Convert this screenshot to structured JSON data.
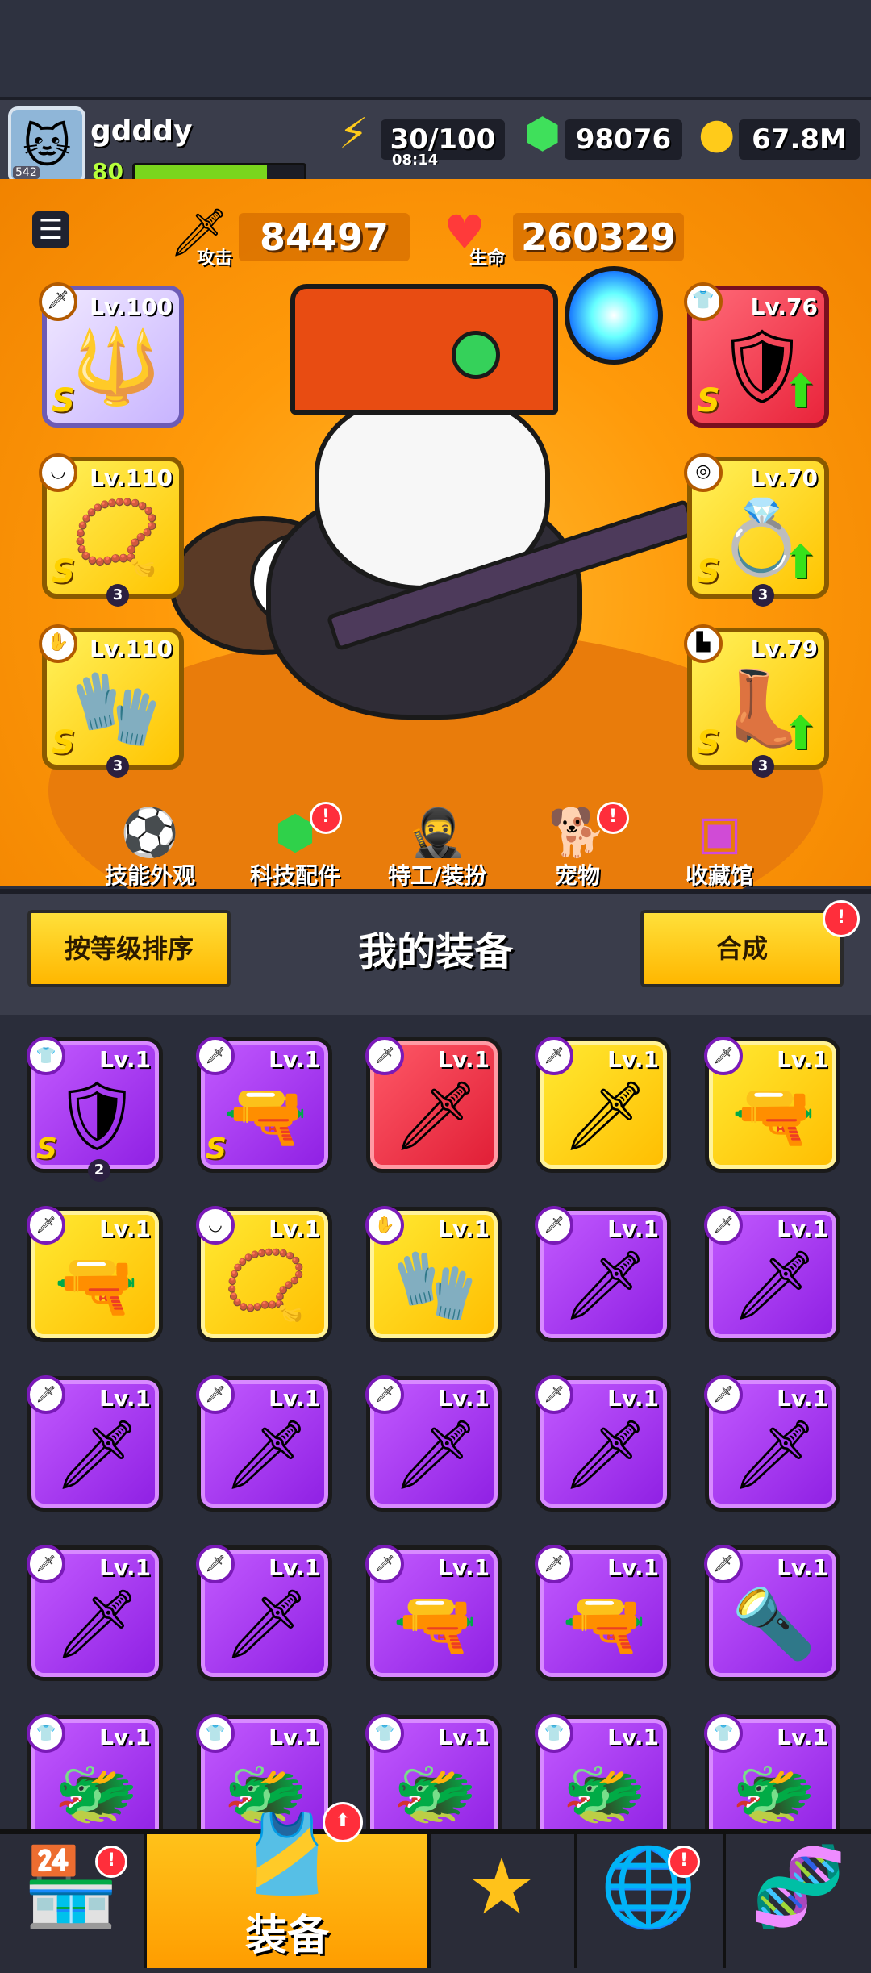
{
  "player": {
    "name": "gdddy",
    "level": "80",
    "xp_fraction": 0.78,
    "avatar_tag": "542"
  },
  "resources": {
    "energy": "30/100",
    "energy_timer": "08:14",
    "gems": "98076",
    "gold": "67.8M"
  },
  "stats": {
    "attack_value": "84497",
    "attack_label": "攻击",
    "hp_value": "260329",
    "hp_label": "生命"
  },
  "equipped": {
    "weapon": {
      "level": "Lv.100",
      "grade": "S",
      "icon": "staff-icon",
      "color": "purple"
    },
    "necklace": {
      "level": "Lv.110",
      "grade": "S",
      "stars": "3",
      "icon": "necklace-icon"
    },
    "gloves": {
      "level": "Lv.110",
      "grade": "S",
      "stars": "3",
      "icon": "gloves-icon"
    },
    "armor": {
      "level": "Lv.76",
      "grade": "S",
      "icon": "armor-icon",
      "color": "red"
    },
    "belt": {
      "level": "Lv.70",
      "grade": "S",
      "stars": "3",
      "icon": "belt-icon"
    },
    "boots": {
      "level": "Lv.79",
      "grade": "S",
      "stars": "3",
      "icon": "boots-icon"
    }
  },
  "hero_nav": [
    {
      "label": "技能外观",
      "icon": "soccer-icon",
      "badge": false
    },
    {
      "label": "科技配件",
      "icon": "tech-icon",
      "badge": true
    },
    {
      "label": "特工/装扮",
      "icon": "agent-icon",
      "badge": false
    },
    {
      "label": "宠物",
      "icon": "dog-icon",
      "badge": true
    },
    {
      "label": "收藏馆",
      "icon": "collection-icon",
      "badge": false
    }
  ],
  "equipment_panel": {
    "sort_button": "按等级排序",
    "title": "我的装备",
    "merge_button": "合成",
    "badge": "!"
  },
  "inventory": [
    {
      "level": "Lv.1",
      "color": "purple",
      "icon": "armor-icon",
      "glyph": "🛡",
      "grade": "S",
      "stars": "2",
      "slot": "armor"
    },
    {
      "level": "Lv.1",
      "color": "purple",
      "icon": "blaster-icon",
      "glyph": "🔫",
      "grade": "S",
      "slot": "weapon"
    },
    {
      "level": "Lv.1",
      "color": "red",
      "icon": "kunai-icon",
      "glyph": "🗡",
      "slot": "weapon"
    },
    {
      "level": "Lv.1",
      "color": "yellow",
      "icon": "kunai-icon",
      "glyph": "🗡",
      "slot": "weapon"
    },
    {
      "level": "Lv.1",
      "color": "yellow",
      "icon": "revolver-icon",
      "glyph": "🔫",
      "slot": "weapon"
    },
    {
      "level": "Lv.1",
      "color": "yellow",
      "icon": "revolver-icon",
      "glyph": "🔫",
      "slot": "weapon"
    },
    {
      "level": "Lv.1",
      "color": "yellow",
      "icon": "fang-necklace-icon",
      "glyph": "📿",
      "slot": "necklace"
    },
    {
      "level": "Lv.1",
      "color": "yellow",
      "icon": "gauntlet-icon",
      "glyph": "🧤",
      "slot": "gloves"
    },
    {
      "level": "Lv.1",
      "color": "purple",
      "icon": "kunai-icon",
      "glyph": "🗡",
      "slot": "weapon"
    },
    {
      "level": "Lv.1",
      "color": "purple",
      "icon": "kunai-icon",
      "glyph": "🗡",
      "slot": "weapon"
    },
    {
      "level": "Lv.1",
      "color": "purple",
      "icon": "kunai-icon",
      "glyph": "🗡",
      "slot": "weapon"
    },
    {
      "level": "Lv.1",
      "color": "purple",
      "icon": "kunai-icon",
      "glyph": "🗡",
      "slot": "weapon"
    },
    {
      "level": "Lv.1",
      "color": "purple",
      "icon": "kunai-icon",
      "glyph": "🗡",
      "slot": "weapon"
    },
    {
      "level": "Lv.1",
      "color": "purple",
      "icon": "kunai-icon",
      "glyph": "🗡",
      "slot": "weapon"
    },
    {
      "level": "Lv.1",
      "color": "purple",
      "icon": "kunai-icon",
      "glyph": "🗡",
      "slot": "weapon"
    },
    {
      "level": "Lv.1",
      "color": "purple",
      "icon": "kunai-icon",
      "glyph": "🗡",
      "slot": "weapon"
    },
    {
      "level": "Lv.1",
      "color": "purple",
      "icon": "kunai-icon",
      "glyph": "🗡",
      "slot": "weapon"
    },
    {
      "level": "Lv.1",
      "color": "purple",
      "icon": "revolver-icon",
      "glyph": "🔫",
      "slot": "weapon"
    },
    {
      "level": "Lv.1",
      "color": "purple",
      "icon": "shotgun-icon",
      "glyph": "🔫",
      "slot": "weapon"
    },
    {
      "level": "Lv.1",
      "color": "purple",
      "icon": "torch-icon",
      "glyph": "🔦",
      "slot": "weapon"
    },
    {
      "level": "Lv.1",
      "color": "purple",
      "icon": "dragon-armor-icon",
      "glyph": "🐲",
      "slot": "armor"
    },
    {
      "level": "Lv.1",
      "color": "purple",
      "icon": "dragon-armor-icon",
      "glyph": "🐲",
      "slot": "armor"
    },
    {
      "level": "Lv.1",
      "color": "purple",
      "icon": "dragon-armor-icon",
      "glyph": "🐲",
      "slot": "armor"
    },
    {
      "level": "Lv.1",
      "color": "purple",
      "icon": "dragon-armor-icon",
      "glyph": "🐲",
      "slot": "armor"
    },
    {
      "level": "Lv.1",
      "color": "purple",
      "icon": "dragon-armor-icon",
      "glyph": "🐲",
      "slot": "armor"
    }
  ],
  "bottom_nav": {
    "shop_icon": "shop-icon",
    "equipment_label": "装备",
    "equipment_icon": "equipment-icon",
    "battle_icon": "battle-icon",
    "planet_icon": "planet-icon",
    "dna_icon": "dna-icon",
    "badge": "!"
  }
}
